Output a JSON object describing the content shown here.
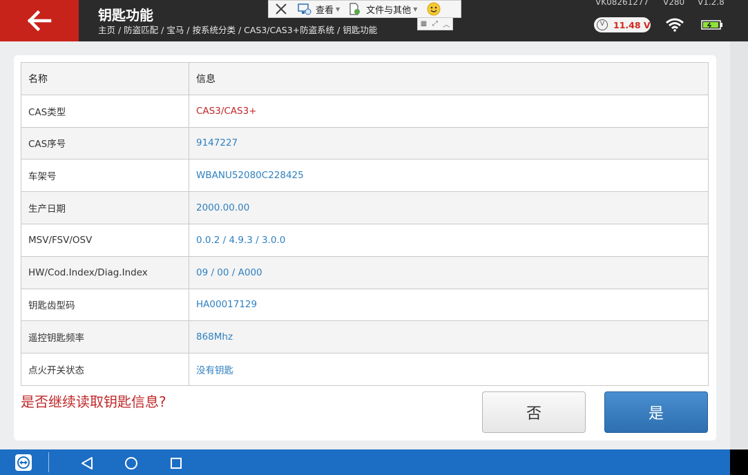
{
  "header": {
    "title": "钥匙功能",
    "breadcrumb": "主页 / 防盗匹配 / 宝马 / 按系统分类 / CAS3/CAS3+防盗系统 / 钥匙功能",
    "serial": "VK08261277",
    "model": "V280",
    "version": "V1.2.8",
    "voltage": "11.48 V",
    "voltage_icon_letter": "V"
  },
  "toolbar": {
    "view_label": "查看",
    "files_label": "文件与其他"
  },
  "table": {
    "headers": [
      "名称",
      "信息"
    ],
    "rows": [
      {
        "name": "CAS类型",
        "value": "CAS3/CAS3+"
      },
      {
        "name": "CAS序号",
        "value": "9147227"
      },
      {
        "name": "车架号",
        "value": "WBANU52080C228425"
      },
      {
        "name": "生产日期",
        "value": "2000.00.00"
      },
      {
        "name": "MSV/FSV/OSV",
        "value": "0.0.2 / 4.9.3 / 3.0.0"
      },
      {
        "name": "HW/Cod.Index/Diag.Index",
        "value": "09 / 00 / A000"
      },
      {
        "name": "钥匙齿型码",
        "value": "HA00017129"
      },
      {
        "name": "遥控钥匙频率",
        "value": "868Mhz"
      },
      {
        "name": "点火开关状态",
        "value": "没有钥匙"
      }
    ]
  },
  "dialog": {
    "prompt": "是否继续读取钥匙信息?",
    "no_label": "否",
    "yes_label": "是"
  },
  "colors": {
    "accent_red": "#c8231a",
    "value_blue": "#2f80c0",
    "button_blue": "#2d6fb1",
    "navbar_blue": "#1c6ec4"
  },
  "icons": [
    "back-arrow-icon",
    "close-icon",
    "view-icon",
    "files-icon",
    "smiley-icon",
    "voltage-icon",
    "wifi-icon",
    "battery-icon",
    "app-icon",
    "nav-back-icon",
    "nav-home-icon",
    "nav-recent-icon"
  ]
}
